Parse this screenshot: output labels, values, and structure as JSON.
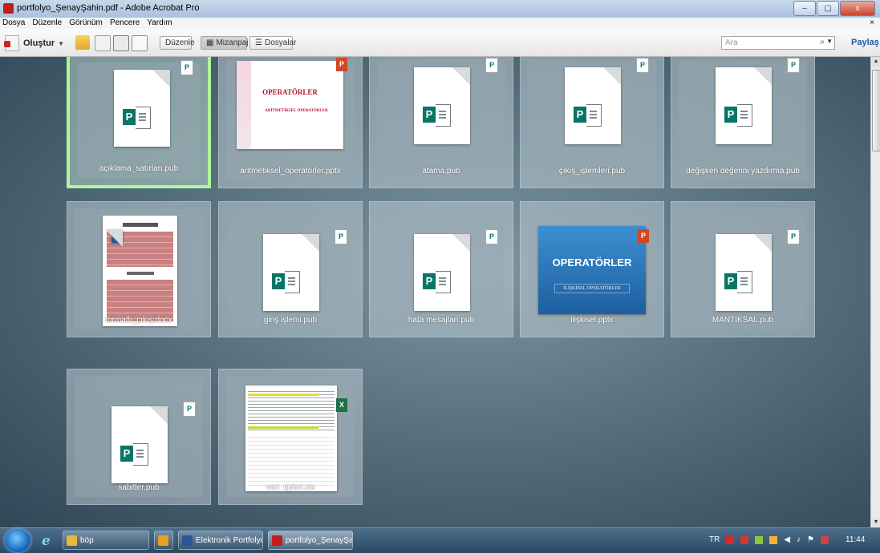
{
  "window": {
    "title": "portfolyo_ŞenayŞahin.pdf - Adobe Acrobat Pro",
    "buttons": {
      "minimize": "–",
      "restore": "▢",
      "close": "x"
    }
  },
  "menu": [
    "Dosya",
    "Düzenle",
    "Görünüm",
    "Pencere",
    "Yardım"
  ],
  "toolbar": {
    "create_label": "Oluştur",
    "edit_label": "Düzenle",
    "layout_label": "Mizanpaj",
    "files_label": "Dosyalar",
    "search_placeholder": "Ara",
    "share_label": "Paylaş"
  },
  "files": [
    {
      "name": "açıklama_satırları.pub",
      "type": "pub",
      "selected": true
    },
    {
      "name": "aritmetiksel_operatörler.pptx",
      "type": "pptx-pink"
    },
    {
      "name": "atama.pub",
      "type": "pub"
    },
    {
      "name": "çıkış_işlemleri.pub",
      "type": "pub"
    },
    {
      "name": "değişken değerini yazdırma.pub",
      "type": "pub"
    },
    {
      "name": "formatlı_çıkış.docx",
      "type": "docx"
    },
    {
      "name": "giriş işlemi.pub",
      "type": "pub"
    },
    {
      "name": "hata mesajları.pub",
      "type": "pub"
    },
    {
      "name": "ilişkisel.pptx",
      "type": "pptx-blue"
    },
    {
      "name": "MANTIKSAL.pub",
      "type": "pub"
    },
    {
      "name": "sabitler.pub",
      "type": "pub"
    },
    {
      "name": "veri_tipleri.xls",
      "type": "xls"
    }
  ],
  "thumbnails": {
    "ppt1_title": "OPERATÖRLER",
    "ppt1_subtitle": "ARİTMETİKSEL OPERATÖRLER",
    "ppt2_title": "OPERATÖRLER",
    "ppt2_subtitle": "İLİŞKİSEL OPERATÖRLER"
  },
  "taskbar": {
    "items": [
      {
        "label": "böp",
        "icon_color": "#e8b83a"
      },
      {
        "label": "",
        "icon_color": "#e8a020"
      },
      {
        "label": "Elektronik Portfolyo1...",
        "icon_color": "#2b579a"
      },
      {
        "label": "portfolyo_ŞenayŞahi...",
        "icon_color": "#c21c1c",
        "active": true
      }
    ],
    "language": "TR",
    "time": "11:44"
  }
}
